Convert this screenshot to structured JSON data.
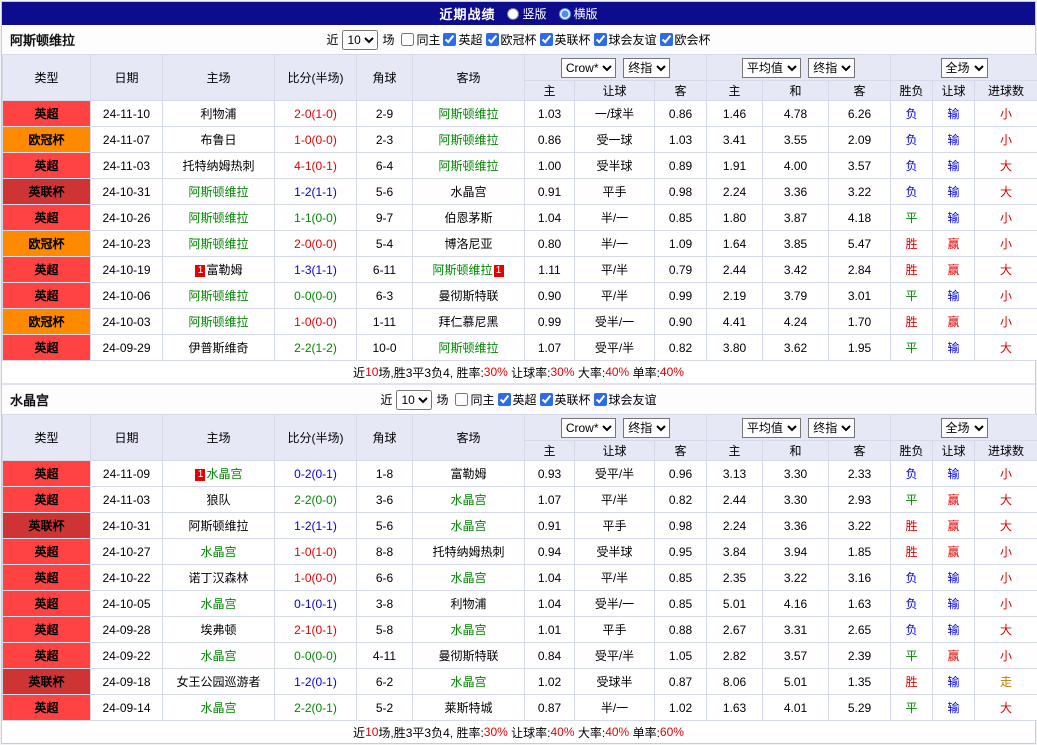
{
  "topbar": {
    "title": "近期战绩",
    "layout_options": [
      {
        "label": "竖版",
        "selected": false
      },
      {
        "label": "横版",
        "selected": true
      }
    ]
  },
  "league_colors": {
    "英超": "#ff4242",
    "欧冠杯": "#ff8a00",
    "英联杯": "#cf3434"
  },
  "sections": [
    {
      "team": "阿斯顿维拉",
      "filter": {
        "near_label": "近",
        "games_value": "10",
        "games_label": "场",
        "checkboxes": [
          {
            "label": "同主",
            "checked": false
          },
          {
            "label": "英超",
            "checked": true
          },
          {
            "label": "欧冠杯",
            "checked": true
          },
          {
            "label": "英联杯",
            "checked": true
          },
          {
            "label": "球会友谊",
            "checked": true
          },
          {
            "label": "欧会杯",
            "checked": true
          }
        ]
      },
      "table": {
        "col_type": "类型",
        "col_date": "日期",
        "col_home": "主场",
        "col_score": "比分(半场)",
        "col_corner": "角球",
        "col_away": "客场",
        "bookmaker": "Crow*",
        "stage1": "终指",
        "avg": "平均值",
        "stage2": "终指",
        "fulltime": "全场",
        "sub": [
          "主",
          "让球",
          "客",
          "主",
          "和",
          "客",
          "胜负",
          "让球",
          "进球数"
        ]
      },
      "rows": [
        {
          "league": "英超",
          "date": "24-11-10",
          "home": {
            "name": "利物浦"
          },
          "score": {
            "text": "2-0(1-0)",
            "color": "#e60000"
          },
          "corners": "2-9",
          "away": {
            "name": "阿斯顿维拉",
            "focus": true
          },
          "odds": [
            "1.03",
            "一/球半",
            "0.86",
            "1.46",
            "4.78",
            "6.26"
          ],
          "results": [
            [
              "负",
              "#0000e0"
            ],
            [
              "输",
              "#0000e0"
            ],
            [
              "小",
              "#e60000"
            ]
          ]
        },
        {
          "league": "欧冠杯",
          "date": "24-11-07",
          "home": {
            "name": "布鲁日"
          },
          "score": {
            "text": "1-0(0-0)",
            "color": "#e60000"
          },
          "corners": "2-3",
          "away": {
            "name": "阿斯顿维拉",
            "focus": true
          },
          "odds": [
            "0.86",
            "受一球",
            "1.03",
            "3.41",
            "3.55",
            "2.09"
          ],
          "results": [
            [
              "负",
              "#0000e0"
            ],
            [
              "输",
              "#0000e0"
            ],
            [
              "小",
              "#e60000"
            ]
          ]
        },
        {
          "league": "英超",
          "date": "24-11-03",
          "home": {
            "name": "托特纳姆热刺"
          },
          "score": {
            "text": "4-1(0-1)",
            "color": "#e60000"
          },
          "corners": "6-4",
          "away": {
            "name": "阿斯顿维拉",
            "focus": true
          },
          "odds": [
            "1.00",
            "受半球",
            "0.89",
            "1.91",
            "4.00",
            "3.57"
          ],
          "results": [
            [
              "负",
              "#0000e0"
            ],
            [
              "输",
              "#0000e0"
            ],
            [
              "大",
              "#e60000"
            ]
          ]
        },
        {
          "league": "英联杯",
          "date": "24-10-31",
          "home": {
            "name": "阿斯顿维拉",
            "focus": true
          },
          "score": {
            "text": "1-2(1-1)",
            "color": "#0000e0"
          },
          "corners": "5-6",
          "away": {
            "name": "水晶宫"
          },
          "odds": [
            "0.91",
            "平手",
            "0.98",
            "2.24",
            "3.36",
            "3.22"
          ],
          "results": [
            [
              "负",
              "#0000e0"
            ],
            [
              "输",
              "#0000e0"
            ],
            [
              "大",
              "#e60000"
            ]
          ]
        },
        {
          "league": "英超",
          "date": "24-10-26",
          "home": {
            "name": "阿斯顿维拉",
            "focus": true
          },
          "score": {
            "text": "1-1(0-0)",
            "color": "#008800"
          },
          "corners": "9-7",
          "away": {
            "name": "伯恩茅斯"
          },
          "odds": [
            "1.04",
            "半/一",
            "0.85",
            "1.80",
            "3.87",
            "4.18"
          ],
          "results": [
            [
              "平",
              "#008800"
            ],
            [
              "输",
              "#0000e0"
            ],
            [
              "小",
              "#e60000"
            ]
          ]
        },
        {
          "league": "欧冠杯",
          "date": "24-10-23",
          "home": {
            "name": "阿斯顿维拉",
            "focus": true
          },
          "score": {
            "text": "2-0(0-0)",
            "color": "#e60000"
          },
          "corners": "5-4",
          "away": {
            "name": "博洛尼亚"
          },
          "odds": [
            "0.80",
            "半/一",
            "1.09",
            "1.64",
            "3.85",
            "5.47"
          ],
          "results": [
            [
              "胜",
              "#e60000"
            ],
            [
              "赢",
              "#e60000"
            ],
            [
              "小",
              "#e60000"
            ]
          ]
        },
        {
          "league": "英超",
          "date": "24-10-19",
          "home": {
            "name": "富勒姆",
            "badge_before": "1"
          },
          "score": {
            "text": "1-3(1-1)",
            "color": "#0000e0"
          },
          "corners": "6-11",
          "away": {
            "name": "阿斯顿维拉",
            "focus": true,
            "badge_after": "1"
          },
          "odds": [
            "1.11",
            "平/半",
            "0.79",
            "2.44",
            "3.42",
            "2.84"
          ],
          "results": [
            [
              "胜",
              "#e60000"
            ],
            [
              "赢",
              "#e60000"
            ],
            [
              "大",
              "#e60000"
            ]
          ]
        },
        {
          "league": "英超",
          "date": "24-10-06",
          "home": {
            "name": "阿斯顿维拉",
            "focus": true
          },
          "score": {
            "text": "0-0(0-0)",
            "color": "#008800"
          },
          "corners": "6-3",
          "away": {
            "name": "曼彻斯特联"
          },
          "odds": [
            "0.90",
            "平/半",
            "0.99",
            "2.19",
            "3.79",
            "3.01"
          ],
          "results": [
            [
              "平",
              "#008800"
            ],
            [
              "输",
              "#0000e0"
            ],
            [
              "小",
              "#e60000"
            ]
          ]
        },
        {
          "league": "欧冠杯",
          "date": "24-10-03",
          "home": {
            "name": "阿斯顿维拉",
            "focus": true
          },
          "score": {
            "text": "1-0(0-0)",
            "color": "#e60000"
          },
          "corners": "1-11",
          "away": {
            "name": "拜仁慕尼黑"
          },
          "odds": [
            "0.99",
            "受半/一",
            "0.90",
            "4.41",
            "4.24",
            "1.70"
          ],
          "results": [
            [
              "胜",
              "#e60000"
            ],
            [
              "赢",
              "#e60000"
            ],
            [
              "小",
              "#e60000"
            ]
          ]
        },
        {
          "league": "英超",
          "date": "24-09-29",
          "home": {
            "name": "伊普斯维奇"
          },
          "score": {
            "text": "2-2(1-2)",
            "color": "#008800"
          },
          "corners": "10-0",
          "away": {
            "name": "阿斯顿维拉",
            "focus": true
          },
          "odds": [
            "1.07",
            "受平/半",
            "0.82",
            "3.80",
            "3.62",
            "1.95"
          ],
          "results": [
            [
              "平",
              "#008800"
            ],
            [
              "输",
              "#0000e0"
            ],
            [
              "大",
              "#e60000"
            ]
          ]
        }
      ],
      "summary": [
        {
          "text": "近",
          "color": "#000000"
        },
        {
          "text": "10",
          "color": "#e60000"
        },
        {
          "text": "场,胜3平3负4, ",
          "color": "#000000"
        },
        {
          "text": "胜率:",
          "color": "#000000"
        },
        {
          "text": "30%",
          "color": "#e60000"
        },
        {
          "text": " 让球率:",
          "color": "#000000"
        },
        {
          "text": "30%",
          "color": "#e60000"
        },
        {
          "text": " 大率:",
          "color": "#000000"
        },
        {
          "text": "40%",
          "color": "#e60000"
        },
        {
          "text": " 单率:",
          "color": "#000000"
        },
        {
          "text": "40%",
          "color": "#e60000"
        }
      ]
    },
    {
      "team": "水晶宫",
      "filter": {
        "near_label": "近",
        "games_value": "10",
        "games_label": "场",
        "checkboxes": [
          {
            "label": "同主",
            "checked": false
          },
          {
            "label": "英超",
            "checked": true
          },
          {
            "label": "英联杯",
            "checked": true
          },
          {
            "label": "球会友谊",
            "checked": true
          }
        ]
      },
      "table": {
        "col_type": "类型",
        "col_date": "日期",
        "col_home": "主场",
        "col_score": "比分(半场)",
        "col_corner": "角球",
        "col_away": "客场",
        "bookmaker": "Crow*",
        "stage1": "终指",
        "avg": "平均值",
        "stage2": "终指",
        "fulltime": "全场",
        "sub": [
          "主",
          "让球",
          "客",
          "主",
          "和",
          "客",
          "胜负",
          "让球",
          "进球数"
        ]
      },
      "rows": [
        {
          "league": "英超",
          "date": "24-11-09",
          "home": {
            "name": "水晶宫",
            "focus": true,
            "badge_before": "1"
          },
          "score": {
            "text": "0-2(0-1)",
            "color": "#0000e0"
          },
          "corners": "1-8",
          "away": {
            "name": "富勒姆"
          },
          "odds": [
            "0.93",
            "受平/半",
            "0.96",
            "3.13",
            "3.30",
            "2.33"
          ],
          "results": [
            [
              "负",
              "#0000e0"
            ],
            [
              "输",
              "#0000e0"
            ],
            [
              "小",
              "#e60000"
            ]
          ]
        },
        {
          "league": "英超",
          "date": "24-11-03",
          "home": {
            "name": "狼队"
          },
          "score": {
            "text": "2-2(0-0)",
            "color": "#008800"
          },
          "corners": "3-6",
          "away": {
            "name": "水晶宫",
            "focus": true
          },
          "odds": [
            "1.07",
            "平/半",
            "0.82",
            "2.44",
            "3.30",
            "2.93"
          ],
          "results": [
            [
              "平",
              "#008800"
            ],
            [
              "赢",
              "#e60000"
            ],
            [
              "大",
              "#e60000"
            ]
          ]
        },
        {
          "league": "英联杯",
          "date": "24-10-31",
          "home": {
            "name": "阿斯顿维拉"
          },
          "score": {
            "text": "1-2(1-1)",
            "color": "#0000e0"
          },
          "corners": "5-6",
          "away": {
            "name": "水晶宫",
            "focus": true
          },
          "odds": [
            "0.91",
            "平手",
            "0.98",
            "2.24",
            "3.36",
            "3.22"
          ],
          "results": [
            [
              "胜",
              "#e60000"
            ],
            [
              "赢",
              "#e60000"
            ],
            [
              "大",
              "#e60000"
            ]
          ]
        },
        {
          "league": "英超",
          "date": "24-10-27",
          "home": {
            "name": "水晶宫",
            "focus": true
          },
          "score": {
            "text": "1-0(1-0)",
            "color": "#e60000"
          },
          "corners": "8-8",
          "away": {
            "name": "托特纳姆热刺"
          },
          "odds": [
            "0.94",
            "受半球",
            "0.95",
            "3.84",
            "3.94",
            "1.85"
          ],
          "results": [
            [
              "胜",
              "#e60000"
            ],
            [
              "赢",
              "#e60000"
            ],
            [
              "小",
              "#e60000"
            ]
          ]
        },
        {
          "league": "英超",
          "date": "24-10-22",
          "home": {
            "name": "诺丁汉森林"
          },
          "score": {
            "text": "1-0(0-0)",
            "color": "#e60000"
          },
          "corners": "6-6",
          "away": {
            "name": "水晶宫",
            "focus": true
          },
          "odds": [
            "1.04",
            "平/半",
            "0.85",
            "2.35",
            "3.22",
            "3.16"
          ],
          "results": [
            [
              "负",
              "#0000e0"
            ],
            [
              "输",
              "#0000e0"
            ],
            [
              "小",
              "#e60000"
            ]
          ]
        },
        {
          "league": "英超",
          "date": "24-10-05",
          "home": {
            "name": "水晶宫",
            "focus": true
          },
          "score": {
            "text": "0-1(0-1)",
            "color": "#0000e0"
          },
          "corners": "3-8",
          "away": {
            "name": "利物浦"
          },
          "odds": [
            "1.04",
            "受半/一",
            "0.85",
            "5.01",
            "4.16",
            "1.63"
          ],
          "results": [
            [
              "负",
              "#0000e0"
            ],
            [
              "输",
              "#0000e0"
            ],
            [
              "小",
              "#e60000"
            ]
          ]
        },
        {
          "league": "英超",
          "date": "24-09-28",
          "home": {
            "name": "埃弗顿"
          },
          "score": {
            "text": "2-1(0-1)",
            "color": "#e60000"
          },
          "corners": "5-8",
          "away": {
            "name": "水晶宫",
            "focus": true
          },
          "odds": [
            "1.01",
            "平手",
            "0.88",
            "2.67",
            "3.31",
            "2.65"
          ],
          "results": [
            [
              "负",
              "#0000e0"
            ],
            [
              "输",
              "#0000e0"
            ],
            [
              "大",
              "#e60000"
            ]
          ]
        },
        {
          "league": "英超",
          "date": "24-09-22",
          "home": {
            "name": "水晶宫",
            "focus": true
          },
          "score": {
            "text": "0-0(0-0)",
            "color": "#008800"
          },
          "corners": "4-11",
          "away": {
            "name": "曼彻斯特联"
          },
          "odds": [
            "0.84",
            "受平/半",
            "1.05",
            "2.82",
            "3.57",
            "2.39"
          ],
          "results": [
            [
              "平",
              "#008800"
            ],
            [
              "赢",
              "#e60000"
            ],
            [
              "小",
              "#e60000"
            ]
          ]
        },
        {
          "league": "英联杯",
          "date": "24-09-18",
          "home": {
            "name": "女王公园巡游者"
          },
          "score": {
            "text": "1-2(0-1)",
            "color": "#0000e0"
          },
          "corners": "6-2",
          "away": {
            "name": "水晶宫",
            "focus": true
          },
          "odds": [
            "1.02",
            "受球半",
            "0.87",
            "8.06",
            "5.01",
            "1.35"
          ],
          "results": [
            [
              "胜",
              "#e60000"
            ],
            [
              "输",
              "#0000e0"
            ],
            [
              "走",
              "#cc7700"
            ]
          ]
        },
        {
          "league": "英超",
          "date": "24-09-14",
          "home": {
            "name": "水晶宫",
            "focus": true
          },
          "score": {
            "text": "2-2(0-1)",
            "color": "#008800"
          },
          "corners": "5-2",
          "away": {
            "name": "莱斯特城"
          },
          "odds": [
            "0.87",
            "半/一",
            "1.02",
            "1.63",
            "4.01",
            "5.29"
          ],
          "results": [
            [
              "平",
              "#008800"
            ],
            [
              "输",
              "#0000e0"
            ],
            [
              "大",
              "#e60000"
            ]
          ]
        }
      ],
      "summary": [
        {
          "text": "近",
          "color": "#000000"
        },
        {
          "text": "10",
          "color": "#e60000"
        },
        {
          "text": "场,胜3平3负4, ",
          "color": "#000000"
        },
        {
          "text": "胜率:",
          "color": "#000000"
        },
        {
          "text": "30%",
          "color": "#e60000"
        },
        {
          "text": " 让球率:",
          "color": "#000000"
        },
        {
          "text": "40%",
          "color": "#e60000"
        },
        {
          "text": " 大率:",
          "color": "#000000"
        },
        {
          "text": "40%",
          "color": "#e60000"
        },
        {
          "text": " 单率:",
          "color": "#000000"
        },
        {
          "text": "60%",
          "color": "#e60000"
        }
      ]
    }
  ]
}
